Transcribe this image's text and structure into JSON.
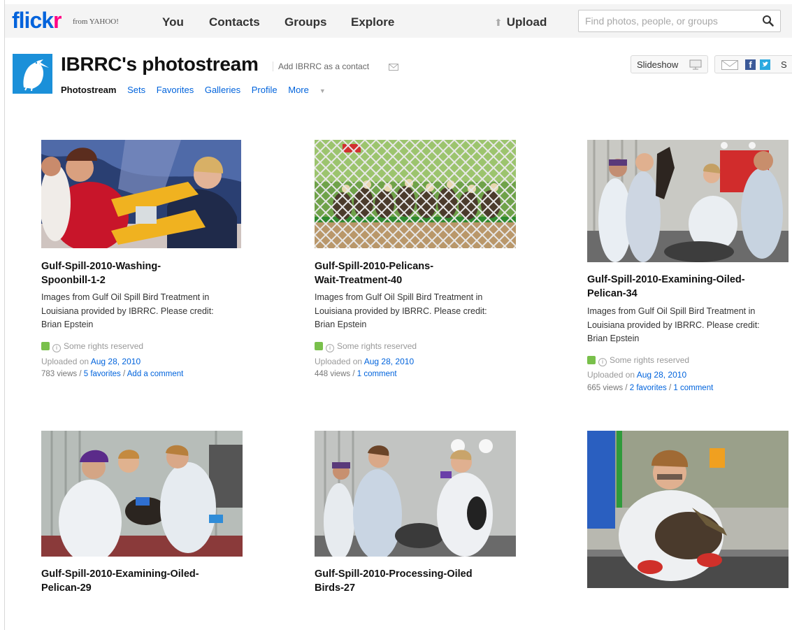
{
  "topbar": {
    "logo_fl": "flick",
    "logo_r": "r",
    "from_yahoo": "from YAHOO!",
    "nav": [
      "You",
      "Contacts",
      "Groups",
      "Explore"
    ],
    "upload": "Upload",
    "search_placeholder": "Find photos, people, or groups"
  },
  "header": {
    "title": "IBRRC's photostream",
    "add_contact": "Add IBRRC as a contact",
    "subnav_current": "Photostream",
    "subnav_links": [
      "Sets",
      "Favorites",
      "Galleries",
      "Profile",
      "More"
    ],
    "slideshow": "Slideshow",
    "share_s": "S"
  },
  "photos": [
    {
      "title_l1": "Gulf-Spill-2010-Washing-",
      "title_l2": "Spoonbill-1-2",
      "desc_l1": "Images from Gulf Oil Spill Bird Treatment in",
      "desc_l2": "Louisiana provided by IBRRC. Please credit:",
      "desc_l3": "Brian Epstein",
      "rights": "Some rights reserved",
      "uploaded_prefix": "Uploaded on",
      "uploaded_date": "Aug 28, 2010",
      "views": "783 views /",
      "favorites": "5 favorites",
      "sep": "/",
      "comments": "Add a comment"
    },
    {
      "title_l1": "Gulf-Spill-2010-Pelicans-",
      "title_l2": "Wait-Treatment-40",
      "desc_l1": "Images from Gulf Oil Spill Bird Treatment in",
      "desc_l2": "Louisiana provided by IBRRC. Please credit:",
      "desc_l3": "Brian Epstein",
      "rights": "Some rights reserved",
      "uploaded_prefix": "Uploaded on",
      "uploaded_date": "Aug 28, 2010",
      "views": "448 views /",
      "favorites": "",
      "sep": "",
      "comments": "1 comment"
    },
    {
      "title_l1": "Gulf-Spill-2010-Examining-Oiled-",
      "title_l2": "Pelican-34",
      "desc_l1": "Images from Gulf Oil Spill Bird Treatment in",
      "desc_l2": "Louisiana provided by IBRRC. Please credit:",
      "desc_l3": "Brian Epstein",
      "rights": "Some rights reserved",
      "uploaded_prefix": "Uploaded on",
      "uploaded_date": "Aug 28, 2010",
      "views": "665 views /",
      "favorites": "2 favorites",
      "sep": "/",
      "comments": "1 comment"
    },
    {
      "title_l1": "Gulf-Spill-2010-Examining-Oiled-",
      "title_l2": "Pelican-29"
    },
    {
      "title_l1": "Gulf-Spill-2010-Processing-Oiled",
      "title_l2": "Birds-27"
    }
  ],
  "colors": {
    "flickr_blue": "#0063dc",
    "flickr_pink": "#ff0084",
    "link": "#0063dc",
    "cc_green": "#79c04b"
  },
  "icons": {
    "search": "magnifier-icon",
    "upload": "up-arrow-icon",
    "slideshow": "monitor-icon",
    "share": [
      "envelope-icon",
      "facebook-icon",
      "twitter-icon"
    ]
  }
}
